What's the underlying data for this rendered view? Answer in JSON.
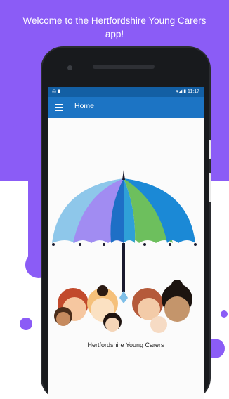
{
  "promo": {
    "headline": "Welcome to the Hertfordshire Young Carers app!"
  },
  "status_bar": {
    "left_icons": "◎ ▮",
    "right_text": "▾◢ ▮ 11:17"
  },
  "app_bar": {
    "title": "Home",
    "menu_icon": "hamburger-menu-icon"
  },
  "hero": {
    "app_name": "Hertfordshire Young Carers",
    "illustration": "umbrella-with-family-faces"
  },
  "colors": {
    "brand_purple": "#8b5cf6",
    "app_bar_blue": "#1c74c4",
    "status_bar_blue": "#135fa4"
  }
}
